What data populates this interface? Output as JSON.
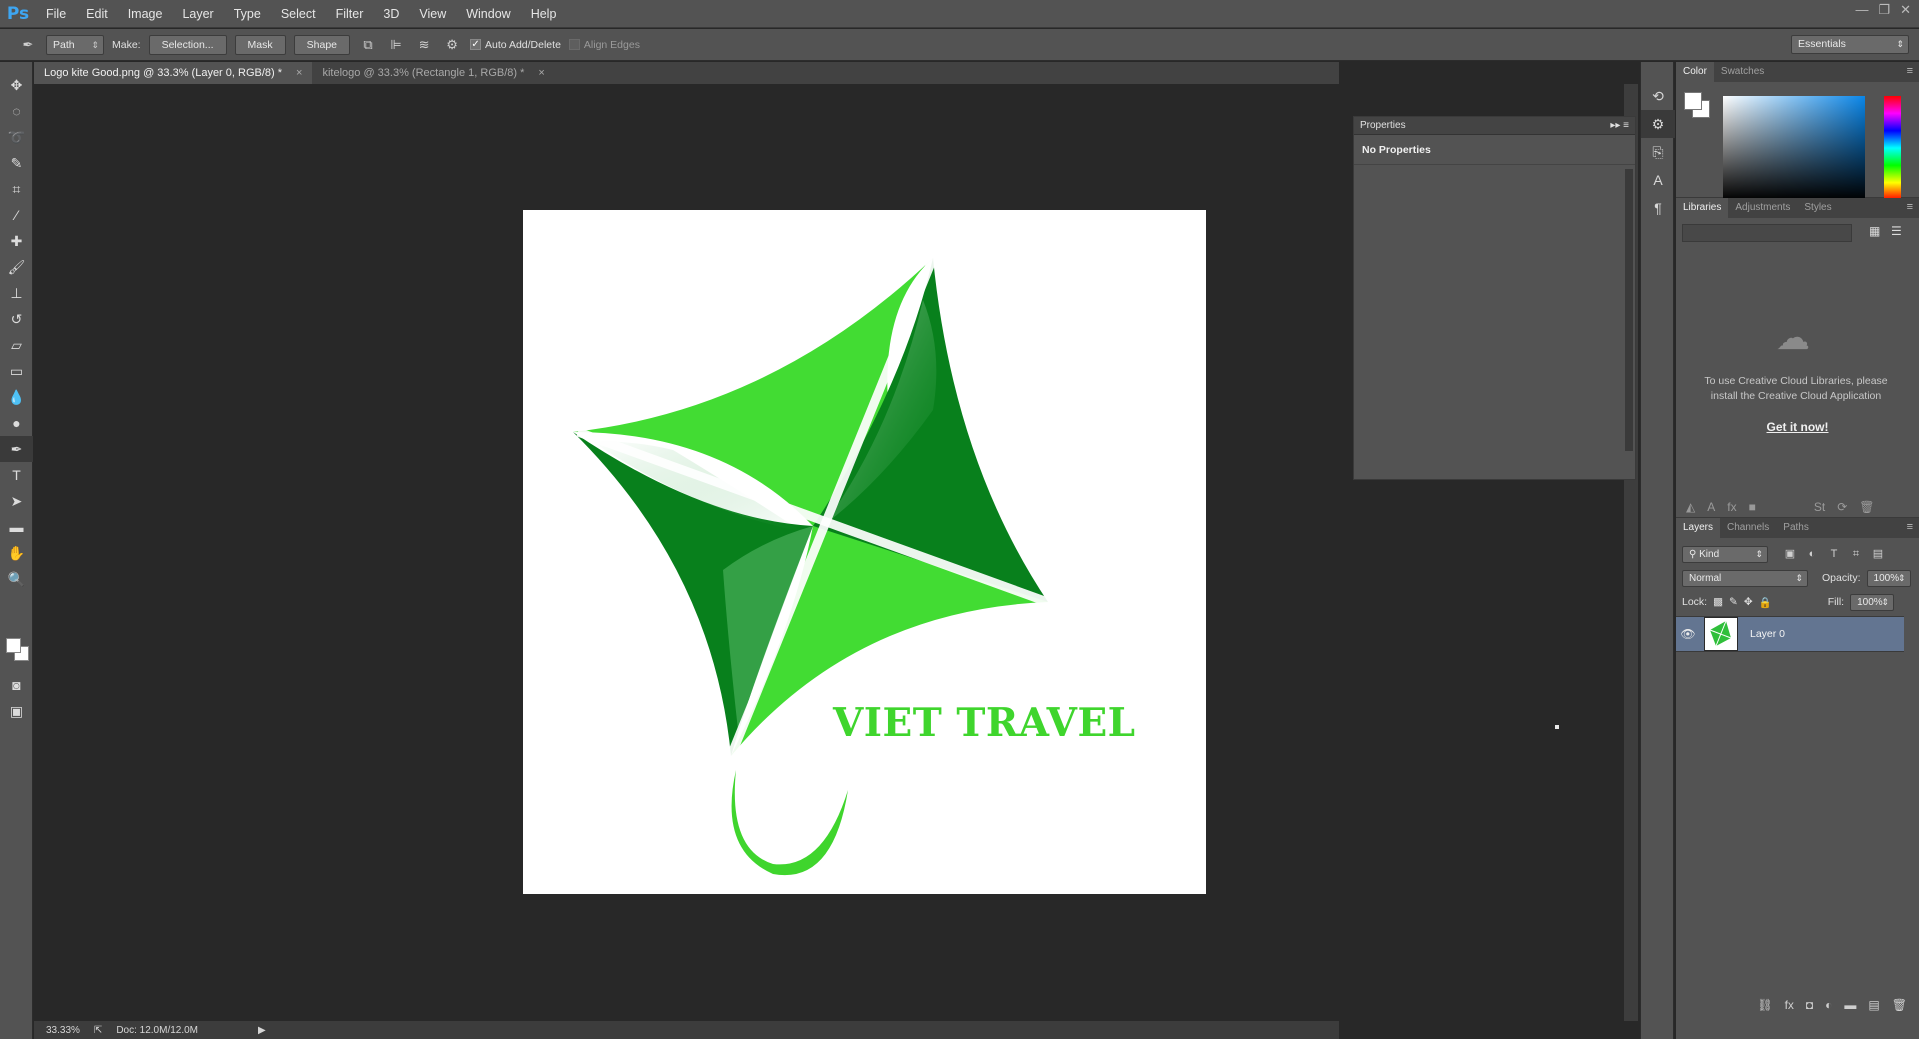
{
  "app": {
    "logo": "Ps"
  },
  "menu": [
    "File",
    "Edit",
    "Image",
    "Layer",
    "Type",
    "Select",
    "Filter",
    "3D",
    "View",
    "Window",
    "Help"
  ],
  "window_controls": {
    "minimize": "—",
    "restore": "❐",
    "close": "✕"
  },
  "options_bar": {
    "tool_icon": "pen-icon",
    "mode_value": "Path",
    "make_label": "Make:",
    "selection_button": "Selection...",
    "mask_button": "Mask",
    "shape_button": "Shape",
    "auto_add_delete_label": "Auto Add/Delete",
    "auto_add_delete_checked": true,
    "align_edges_label": "Align Edges",
    "align_edges_checked": false,
    "workspace_value": "Essentials"
  },
  "tabs": [
    {
      "label": "Logo kite Good.png @ 33.3% (Layer 0, RGB/8) *",
      "active": true
    },
    {
      "label": "kitelogo @ 33.3% (Rectangle 1, RGB/8) *",
      "active": false
    }
  ],
  "canvas": {
    "logo_text": "VIET TRAVEL",
    "colors": {
      "light_green": "#42dc33",
      "dark_green": "#08801c",
      "text_green": "#3fd52d",
      "mid_green": "#2fa846"
    }
  },
  "status_bar": {
    "zoom": "33.33%",
    "doc_info": "Doc: 12.0M/12.0M"
  },
  "properties_panel": {
    "title": "Properties",
    "content": "No Properties"
  },
  "color_panel": {
    "tabs": [
      "Color",
      "Swatches"
    ],
    "active_tab": "Color"
  },
  "libraries_panel": {
    "tabs": [
      "Libraries",
      "Adjustments",
      "Styles"
    ],
    "active_tab": "Libraries",
    "message": "To use Creative Cloud Libraries, please install the Creative Cloud Application",
    "link": "Get it now!"
  },
  "layers_panel": {
    "tabs": [
      "Layers",
      "Channels",
      "Paths"
    ],
    "active_tab": "Layers",
    "filter_kind": "Kind",
    "blend_mode": "Normal",
    "opacity_label": "Opacity:",
    "opacity_value": "100%",
    "lock_label": "Lock:",
    "fill_label": "Fill:",
    "fill_value": "100%",
    "layers": [
      {
        "name": "Layer 0",
        "visible": true,
        "selected": true
      }
    ]
  }
}
